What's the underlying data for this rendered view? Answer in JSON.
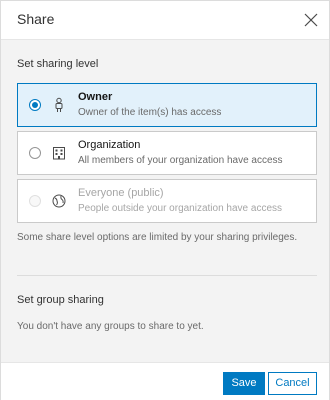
{
  "dialog": {
    "title": "Share",
    "close_icon": "close-icon"
  },
  "sharing_level": {
    "title": "Set sharing level",
    "options": [
      {
        "label": "Owner",
        "description": "Owner of the item(s) has access",
        "icon": "person-icon",
        "selected": true,
        "disabled": false
      },
      {
        "label": "Organization",
        "description": "All members of your organization have access",
        "icon": "building-icon",
        "selected": false,
        "disabled": false
      },
      {
        "label": "Everyone (public)",
        "description": "People outside your organization have access",
        "icon": "globe-icon",
        "selected": false,
        "disabled": true
      }
    ],
    "note": "Some share level options are limited by your sharing privileges."
  },
  "group_sharing": {
    "title": "Set group sharing",
    "note": "You don't have any groups to share to yet."
  },
  "footer": {
    "save_label": "Save",
    "cancel_label": "Cancel"
  },
  "colors": {
    "accent": "#007ac2",
    "selected_bg": "#e2f1fb",
    "panel_bg": "#f3f3f3"
  }
}
